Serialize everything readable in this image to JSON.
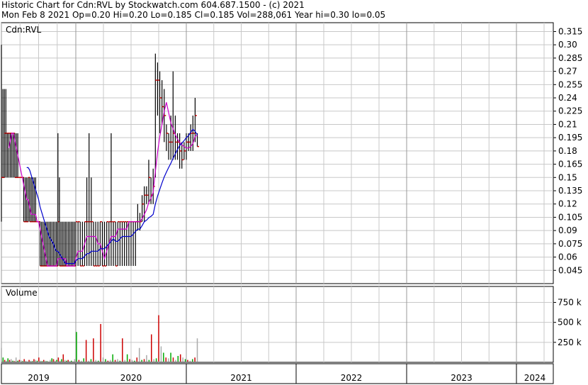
{
  "header": {
    "line1": "Historic Chart for Cdn:RVL by Stockwatch.com 604.687.1500 - (c) 2021",
    "line2": "Mon Feb  8 2021  Op=0.20  Hi=0.20  Lo=0.185  Cl=0.185  Vol=288,061  Year hi=0.30  lo=0.05"
  },
  "colors": {
    "price_bar": "#000000",
    "close_tick": "#cc0000",
    "ma_short": "#cc00cc",
    "ma_long": "#0000cc",
    "vol_up": "#00aa00",
    "vol_down": "#cc0000",
    "vol_flat": "#aaaaaa",
    "grid": "#c8c8c8"
  },
  "chart_data": [
    {
      "type": "line",
      "panel": "price",
      "label": "Cdn:RVL",
      "ylim": [
        0.03,
        0.325
      ],
      "y_ticks": [
        "0.315",
        "0.30",
        "0.285",
        "0.27",
        "0.255",
        "0.24",
        "0.225",
        "0.21",
        "0.195",
        "0.18",
        "0.165",
        "0.15",
        "0.135",
        "0.12",
        "0.105",
        "0.09",
        "0.075",
        "0.06",
        "0.045"
      ],
      "grid": true,
      "series": [
        {
          "values": [
            [
              2019.0,
              0.1,
              0.3,
              0.15
            ],
            [
              2019.02,
              0.15,
              0.25,
              0.15
            ],
            [
              2019.04,
              0.15,
              0.25,
              0.2
            ],
            [
              2019.06,
              0.15,
              0.25,
              0.2
            ],
            [
              2019.08,
              0.15,
              0.2,
              0.2
            ],
            [
              2019.1,
              0.15,
              0.2,
              0.2
            ],
            [
              2019.12,
              0.15,
              0.2,
              0.2
            ],
            [
              2019.14,
              0.15,
              0.2,
              0.2
            ],
            [
              2019.16,
              0.15,
              0.2,
              0.2
            ],
            [
              2019.18,
              0.15,
              0.2,
              0.15
            ],
            [
              2019.2,
              0.15,
              0.2,
              0.15
            ],
            [
              2019.22,
              0.15,
              0.2,
              0.15
            ],
            [
              2019.24,
              0.15,
              0.15,
              0.15
            ],
            [
              2019.26,
              0.15,
              0.15,
              0.15
            ],
            [
              2019.28,
              0.15,
              0.15,
              0.15
            ],
            [
              2019.3,
              0.1,
              0.15,
              0.1
            ],
            [
              2019.32,
              0.1,
              0.15,
              0.1
            ],
            [
              2019.34,
              0.1,
              0.15,
              0.1
            ],
            [
              2019.36,
              0.1,
              0.15,
              0.15
            ],
            [
              2019.38,
              0.1,
              0.15,
              0.1
            ],
            [
              2019.4,
              0.1,
              0.15,
              0.1
            ],
            [
              2019.42,
              0.1,
              0.15,
              0.1
            ],
            [
              2019.44,
              0.1,
              0.15,
              0.1
            ],
            [
              2019.46,
              0.1,
              0.15,
              0.1
            ],
            [
              2019.48,
              0.1,
              0.1,
              0.1
            ],
            [
              2019.5,
              0.1,
              0.1,
              0.1
            ],
            [
              2019.52,
              0.05,
              0.1,
              0.05
            ],
            [
              2019.54,
              0.05,
              0.1,
              0.05
            ],
            [
              2019.56,
              0.05,
              0.1,
              0.05
            ],
            [
              2019.58,
              0.05,
              0.1,
              0.05
            ],
            [
              2019.6,
              0.05,
              0.1,
              0.05
            ],
            [
              2019.62,
              0.05,
              0.1,
              0.05
            ],
            [
              2019.64,
              0.05,
              0.1,
              0.05
            ],
            [
              2019.66,
              0.05,
              0.1,
              0.05
            ],
            [
              2019.68,
              0.05,
              0.1,
              0.05
            ],
            [
              2019.7,
              0.05,
              0.1,
              0.05
            ],
            [
              2019.72,
              0.05,
              0.1,
              0.05
            ],
            [
              2019.74,
              0.05,
              0.1,
              0.05
            ],
            [
              2019.76,
              0.05,
              0.2,
              0.1
            ],
            [
              2019.78,
              0.05,
              0.15,
              0.05
            ],
            [
              2019.8,
              0.05,
              0.1,
              0.05
            ],
            [
              2019.82,
              0.05,
              0.1,
              0.05
            ],
            [
              2019.84,
              0.05,
              0.1,
              0.05
            ],
            [
              2019.86,
              0.05,
              0.1,
              0.05
            ],
            [
              2019.88,
              0.05,
              0.1,
              0.05
            ],
            [
              2019.9,
              0.05,
              0.1,
              0.05
            ],
            [
              2019.92,
              0.05,
              0.1,
              0.05
            ],
            [
              2019.94,
              0.05,
              0.1,
              0.05
            ],
            [
              2019.96,
              0.05,
              0.1,
              0.05
            ],
            [
              2019.98,
              0.05,
              0.1,
              0.05
            ],
            [
              2020.0,
              0.05,
              0.1,
              0.1
            ],
            [
              2020.02,
              0.05,
              0.1,
              0.1
            ],
            [
              2020.04,
              0.05,
              0.1,
              0.05
            ],
            [
              2020.06,
              0.05,
              0.1,
              0.05
            ],
            [
              2020.08,
              0.05,
              0.1,
              0.1
            ],
            [
              2020.1,
              0.05,
              0.15,
              0.1
            ],
            [
              2020.12,
              0.05,
              0.2,
              0.1
            ],
            [
              2020.14,
              0.05,
              0.15,
              0.1
            ],
            [
              2020.16,
              0.05,
              0.1,
              0.05
            ],
            [
              2020.18,
              0.05,
              0.1,
              0.05
            ],
            [
              2020.2,
              0.05,
              0.1,
              0.05
            ],
            [
              2020.22,
              0.05,
              0.1,
              0.1
            ],
            [
              2020.24,
              0.05,
              0.1,
              0.05
            ],
            [
              2020.26,
              0.05,
              0.1,
              0.05
            ],
            [
              2020.28,
              0.05,
              0.1,
              0.1
            ],
            [
              2020.3,
              0.05,
              0.1,
              0.1
            ],
            [
              2020.32,
              0.05,
              0.2,
              0.1
            ],
            [
              2020.34,
              0.05,
              0.1,
              0.1
            ],
            [
              2020.36,
              0.05,
              0.1,
              0.05
            ],
            [
              2020.38,
              0.05,
              0.1,
              0.1
            ],
            [
              2020.4,
              0.05,
              0.1,
              0.1
            ],
            [
              2020.42,
              0.05,
              0.1,
              0.1
            ],
            [
              2020.44,
              0.05,
              0.1,
              0.1
            ],
            [
              2020.46,
              0.05,
              0.1,
              0.1
            ],
            [
              2020.48,
              0.05,
              0.1,
              0.1
            ],
            [
              2020.5,
              0.05,
              0.1,
              0.1
            ],
            [
              2020.52,
              0.05,
              0.1,
              0.1
            ],
            [
              2020.54,
              0.05,
              0.1,
              0.1
            ],
            [
              2020.56,
              0.09,
              0.12,
              0.1
            ],
            [
              2020.58,
              0.09,
              0.11,
              0.1
            ],
            [
              2020.6,
              0.1,
              0.13,
              0.12
            ],
            [
              2020.62,
              0.1,
              0.14,
              0.13
            ],
            [
              2020.64,
              0.12,
              0.14,
              0.13
            ],
            [
              2020.66,
              0.12,
              0.17,
              0.15
            ],
            [
              2020.68,
              0.12,
              0.15,
              0.13
            ],
            [
              2020.7,
              0.12,
              0.16,
              0.14
            ],
            [
              2020.72,
              0.15,
              0.29,
              0.26
            ],
            [
              2020.74,
              0.22,
              0.28,
              0.26
            ],
            [
              2020.76,
              0.2,
              0.27,
              0.24
            ],
            [
              2020.78,
              0.21,
              0.26,
              0.23
            ],
            [
              2020.8,
              0.19,
              0.25,
              0.22
            ],
            [
              2020.82,
              0.18,
              0.21,
              0.2
            ],
            [
              2020.84,
              0.17,
              0.2,
              0.19
            ],
            [
              2020.86,
              0.17,
              0.22,
              0.19
            ],
            [
              2020.88,
              0.17,
              0.27,
              0.2
            ],
            [
              2020.9,
              0.17,
              0.22,
              0.19
            ],
            [
              2020.92,
              0.17,
              0.2,
              0.19
            ],
            [
              2020.94,
              0.16,
              0.2,
              0.18
            ],
            [
              2020.96,
              0.16,
              0.19,
              0.17
            ],
            [
              2020.98,
              0.17,
              0.19,
              0.18
            ],
            [
              2021.0,
              0.17,
              0.2,
              0.19
            ],
            [
              2021.02,
              0.18,
              0.2,
              0.19
            ],
            [
              2021.04,
              0.18,
              0.21,
              0.2
            ],
            [
              2021.06,
              0.18,
              0.22,
              0.2
            ],
            [
              2021.08,
              0.19,
              0.24,
              0.22
            ],
            [
              2021.1,
              0.185,
              0.2,
              0.185
            ]
          ]
        }
      ]
    },
    {
      "type": "bar",
      "panel": "volume",
      "label": "Volume",
      "y_ticks": [
        "750 k",
        "500 k",
        "250 k"
      ],
      "ylim": [
        0,
        950
      ],
      "unit": "k shares",
      "values": [
        180,
        60,
        30,
        20,
        50,
        30,
        40,
        20,
        15,
        60,
        20,
        30,
        25,
        15,
        40,
        20,
        10,
        30,
        20,
        15,
        40,
        30,
        20,
        60,
        20,
        15,
        30,
        20,
        15,
        10,
        30,
        50,
        40,
        20,
        30,
        60,
        20,
        40,
        100,
        30,
        20,
        30,
        15,
        20,
        10,
        40,
        380,
        30,
        20,
        50,
        280,
        20,
        40,
        300,
        30,
        20,
        480,
        60,
        40,
        20,
        30,
        100,
        30,
        40,
        20,
        300,
        30,
        100,
        40,
        30,
        20,
        60,
        180,
        30,
        40,
        90,
        30,
        350,
        40,
        50,
        590,
        200,
        120,
        60,
        50,
        120,
        60,
        30,
        80,
        100,
        60,
        40,
        30,
        20,
        40,
        60,
        300
      ]
    }
  ],
  "x_axis": {
    "labels": [
      "2019",
      "2020",
      "2021",
      "2022",
      "2023",
      "2024"
    ]
  }
}
